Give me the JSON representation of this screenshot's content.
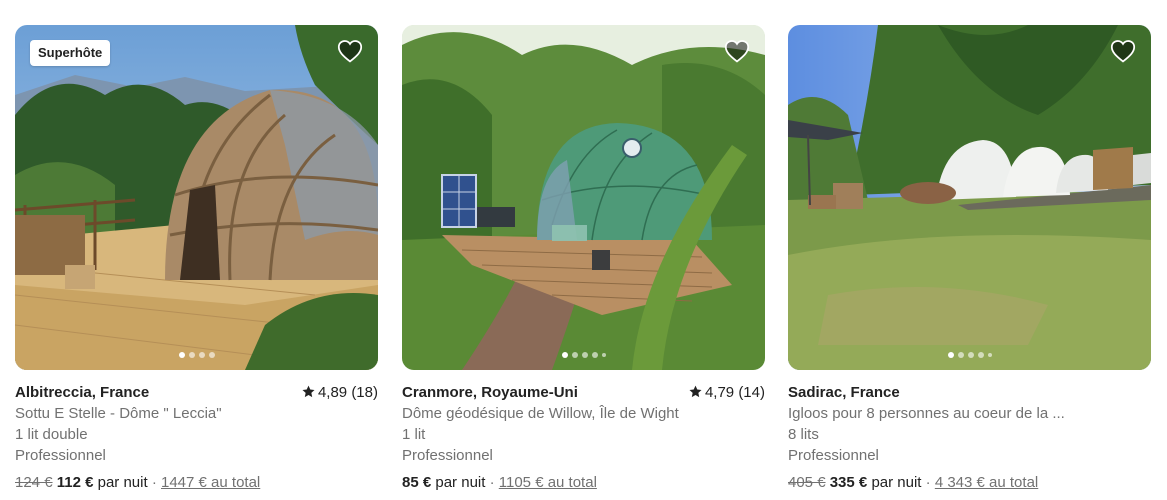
{
  "listings": [
    {
      "badge": "Superhôte",
      "location": "Albitreccia, France",
      "rating": "4,89 (18)",
      "title": "Sottu E Stelle - Dôme \" Leccia\"",
      "beds": "1 lit double",
      "host_type": "Professionnel",
      "old_price": "124 €",
      "price": "112 €",
      "per_night": "par nuit",
      "separator": "·",
      "total": "1447 € au total"
    },
    {
      "location": "Cranmore, Royaume-Uni",
      "rating": "4,79 (14)",
      "title": "Dôme géodésique de Willow, Île de Wight",
      "beds": "1 lit",
      "host_type": "Professionnel",
      "price": "85 €",
      "per_night": "par nuit",
      "separator": "·",
      "total": "1105 € au total"
    },
    {
      "location": "Sadirac, France",
      "title": "Igloos pour 8 personnes au coeur de la ...",
      "beds": "8 lits",
      "host_type": "Professionnel",
      "old_price": "405 €",
      "price": "335 €",
      "per_night": "par nuit",
      "separator": "·",
      "total": "4 343 € au total"
    }
  ],
  "icons": {
    "favorite": "heart-icon",
    "rating": "star-icon"
  },
  "colors": {
    "text": "#222222",
    "secondary": "#717171"
  }
}
